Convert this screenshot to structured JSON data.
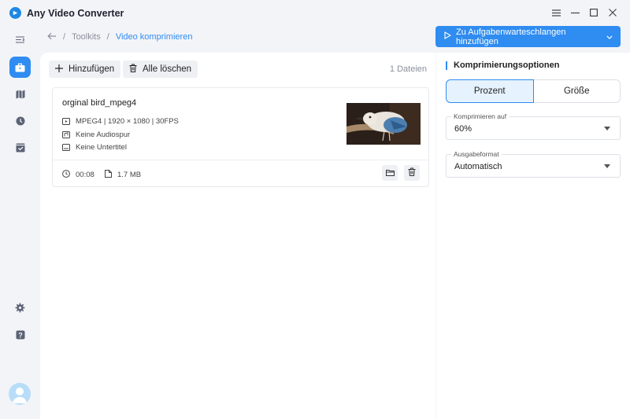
{
  "app": {
    "title": "Any Video Converter"
  },
  "breadcrumb": {
    "parent": "Toolkits",
    "separator": "/",
    "current": "Video komprimieren"
  },
  "actions": {
    "queue_label": "Zu Aufgabenwarteschlangen hinzufügen"
  },
  "toolbar": {
    "add_label": "Hinzufügen",
    "clear_label": "Alle löschen",
    "file_count": "1 Dateien"
  },
  "file": {
    "name": "orginal bird_mpeg4",
    "video": "MPEG4 | 1920 × 1080 | 30FPS",
    "audio": "Keine Audiospur",
    "subtitle": "Keine Untertitel",
    "duration": "00:08",
    "size": "1.7 MB"
  },
  "options": {
    "title": "Komprimierungsoptionen",
    "mode_percent": "Prozent",
    "mode_size": "Größe",
    "compress_label": "Komprimieren auf",
    "compress_value": "60%",
    "format_label": "Ausgabeformat",
    "format_value": "Automatisch"
  },
  "colors": {
    "accent": "#2f8cf0",
    "selected_bg": "#e6f2fd"
  }
}
